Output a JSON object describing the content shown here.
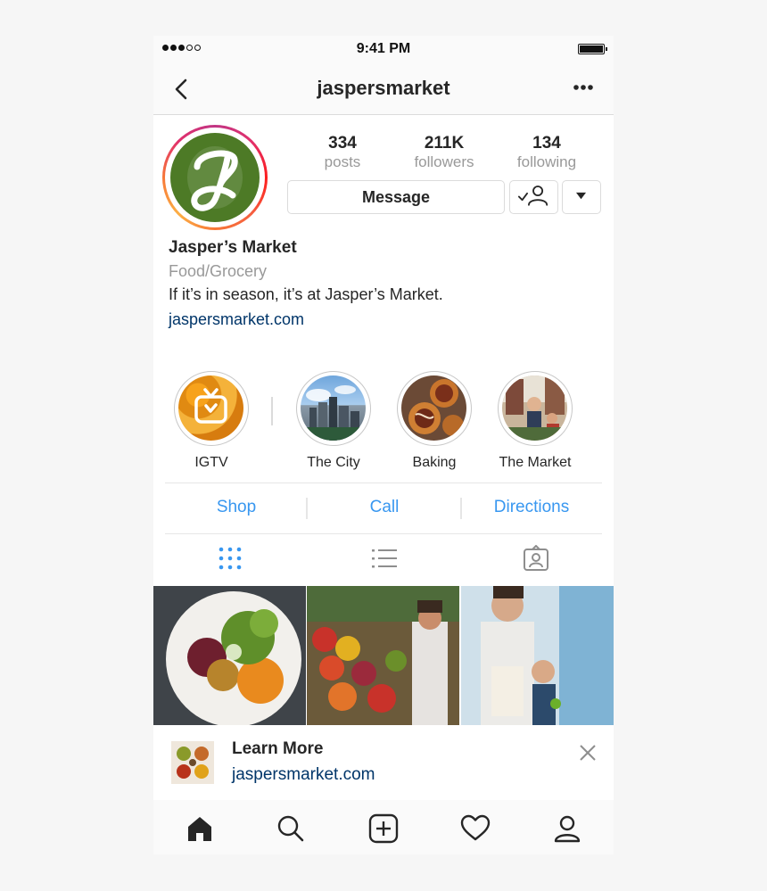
{
  "status_bar": {
    "time": "9:41 PM"
  },
  "nav": {
    "title": "jaspersmarket"
  },
  "profile": {
    "stats": [
      {
        "value": "334",
        "label": "posts"
      },
      {
        "value": "211K",
        "label": "followers"
      },
      {
        "value": "134",
        "label": "following"
      }
    ],
    "message_label": "Message",
    "name": "Jasper’s Market",
    "category": "Food/Grocery",
    "bio": "If it’s in season, it’s at Jasper’s Market.",
    "website": "jaspersmarket.com"
  },
  "highlights": [
    {
      "label": "IGTV"
    },
    {
      "label": "The City"
    },
    {
      "label": "Baking"
    },
    {
      "label": "The Market"
    }
  ],
  "actions": [
    {
      "label": "Shop"
    },
    {
      "label": "Call"
    },
    {
      "label": "Directions"
    }
  ],
  "promo": {
    "title": "Learn More",
    "link": "jaspersmarket.com"
  },
  "tabbar": {
    "icons": [
      "home-icon",
      "search-icon",
      "add-post-icon",
      "heart-icon",
      "profile-icon"
    ]
  },
  "colors": {
    "link_blue": "#3897f0",
    "url_navy": "#003569",
    "logo_green": "#4d7a26"
  }
}
